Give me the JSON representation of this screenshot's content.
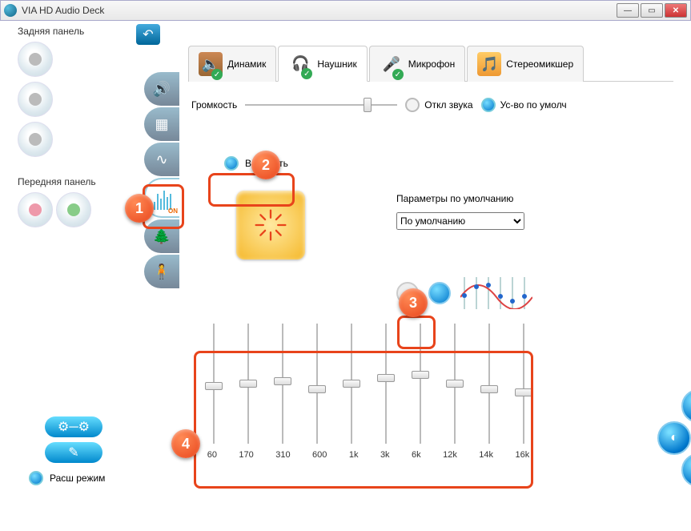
{
  "window": {
    "title": "VIA HD Audio Deck"
  },
  "left": {
    "rear_label": "Задняя панель",
    "front_label": "Передняя панель",
    "mode_label": "Расш режим"
  },
  "tabs": {
    "speaker": "Динамик",
    "headphone": "Наушник",
    "mic": "Микрофон",
    "mixer": "Стереомикшер"
  },
  "volume": {
    "label": "Громкость",
    "mute_label": "Откл звука",
    "default_label": "Ус-во по умолч",
    "position_pct": 82
  },
  "eq_toggle": {
    "enable_label": "Включить",
    "on_badge": "ON"
  },
  "preset": {
    "label": "Параметры по умолчанию",
    "selected": "По умолчанию",
    "options": [
      "По умолчанию"
    ]
  },
  "equalizer": {
    "bands": [
      "60",
      "170",
      "310",
      "600",
      "1k",
      "3k",
      "6k",
      "12k",
      "14k",
      "16k"
    ],
    "gain_pct": [
      48,
      50,
      52,
      45,
      50,
      55,
      58,
      50,
      45,
      42
    ]
  },
  "callouts": {
    "c1": "1",
    "c2": "2",
    "c3": "3",
    "c4": "4"
  }
}
